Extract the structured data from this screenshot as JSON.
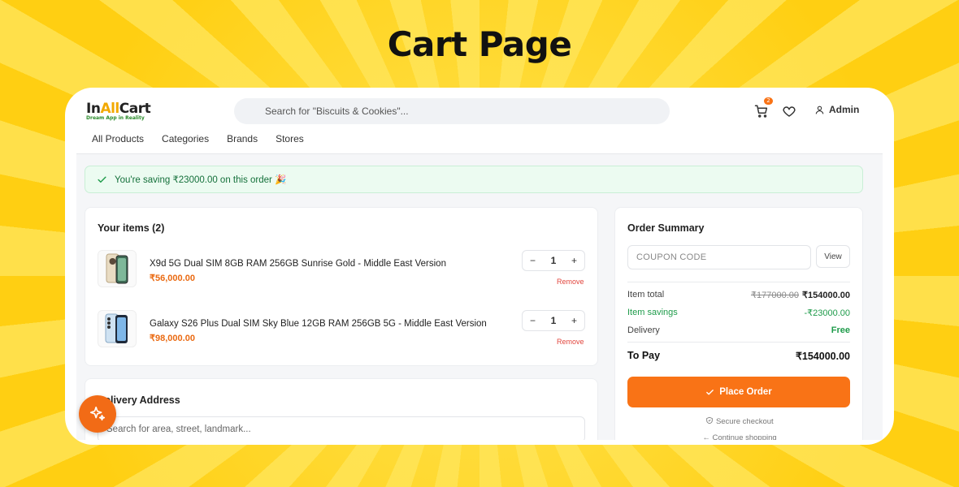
{
  "banner": {
    "title": "Cart Page"
  },
  "brand": {
    "name_prefix": "In",
    "name_accent": "All",
    "name_suffix": "Cart",
    "tagline": "Dream App in Reality"
  },
  "search": {
    "placeholder": "Search for \"Biscuits & Cookies\"..."
  },
  "header": {
    "cart_count": "2",
    "user_label": "Admin"
  },
  "nav": {
    "items": [
      "All Products",
      "Categories",
      "Brands",
      "Stores"
    ]
  },
  "savings": {
    "message": "You're saving ₹23000.00 on this order 🎉"
  },
  "cart": {
    "title": "Your items (2)",
    "items": [
      {
        "name": "X9d 5G Dual SIM 8GB RAM 256GB Sunrise Gold - Middle East Version",
        "price": "₹56,000.00",
        "qty": "1",
        "minus": "−",
        "plus": "+",
        "remove": "Remove"
      },
      {
        "name": "Galaxy S26 Plus Dual SIM Sky Blue 12GB RAM 256GB 5G - Middle East Version",
        "price": "₹98,000.00",
        "qty": "1",
        "minus": "−",
        "plus": "+",
        "remove": "Remove"
      }
    ]
  },
  "address": {
    "title": "Delivery Address",
    "placeholder": "Search for area, street, landmark..."
  },
  "summary": {
    "title": "Order Summary",
    "coupon_placeholder": "COUPON CODE",
    "view_label": "View",
    "item_total_label": "Item total",
    "item_total_original": "₹177000.00",
    "item_total_value": "₹154000.00",
    "savings_label": "Item savings",
    "savings_value": "-₹23000.00",
    "delivery_label": "Delivery",
    "delivery_value": "Free",
    "to_pay_label": "To Pay",
    "to_pay_value": "₹154000.00",
    "place_order_label": "Place Order",
    "secure_label": "Secure checkout",
    "continue_label": "← Continue shopping"
  },
  "colors": {
    "accent": "#f97316",
    "success": "#1e9b4a",
    "danger": "#e2463e",
    "brand_yellow": "#ffd21a"
  }
}
